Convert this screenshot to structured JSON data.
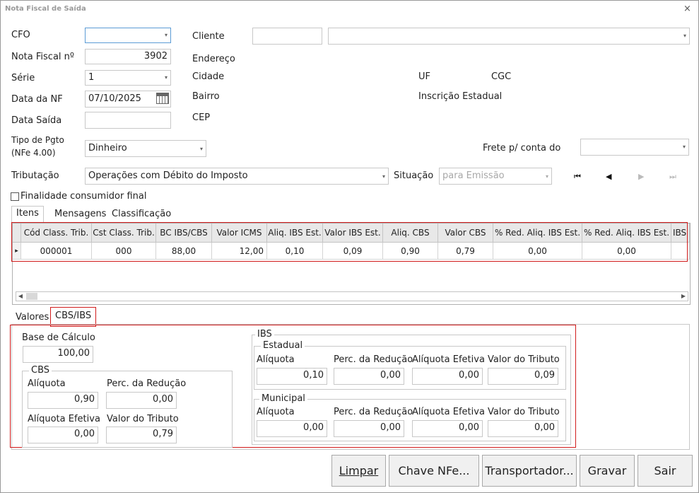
{
  "window": {
    "title": "Nota Fiscal de Saída",
    "close": "×"
  },
  "form": {
    "cfo": {
      "label": "CFO",
      "value": ""
    },
    "nota_fiscal": {
      "label": "Nota Fiscal nº",
      "value": "3902"
    },
    "serie": {
      "label": "Série",
      "value": "1"
    },
    "data_nf": {
      "label": "Data da NF",
      "value": "07/10/2025"
    },
    "data_saida": {
      "label": "Data Saída",
      "value": ""
    },
    "tipo_pgto": {
      "label1": "Tipo de Pgto",
      "label2": "(NFe 4.00)",
      "value": "Dinheiro"
    },
    "tributacao": {
      "label": "Tributação",
      "value": "Operações com Débito do Imposto"
    },
    "situacao": {
      "label": "Situação",
      "value": "para Emissão"
    },
    "cliente": {
      "label": "Cliente",
      "code": "",
      "name": ""
    },
    "endereco": {
      "label": "Endereço"
    },
    "cidade": {
      "label": "Cidade"
    },
    "bairro": {
      "label": "Bairro"
    },
    "cep": {
      "label": "CEP"
    },
    "uf": {
      "label": "UF"
    },
    "cgc": {
      "label": "CGC"
    },
    "inscricao": {
      "label": "Inscrição Estadual"
    },
    "frete": {
      "label": "Frete p/ conta do",
      "value": ""
    },
    "consumidor_final": {
      "label": "Finalidade consumidor final",
      "checked": false
    }
  },
  "nav": {
    "first": "⏮",
    "prev": "◀",
    "next": "▶",
    "last": "⏭"
  },
  "top_tabs": [
    "Itens",
    "Mensagens",
    "Classificação"
  ],
  "grid": {
    "columns": [
      "Cód Class. Trib.",
      "Cst Class. Trib.",
      "BC IBS/CBS",
      "Valor ICMS",
      "Aliq. IBS Est.",
      "Valor IBS Est.",
      "Aliq. CBS",
      "Valor CBS",
      "% Red. Aliq. IBS Est.",
      "% Red. Aliq. IBS Est.",
      "IBS"
    ],
    "rows": [
      [
        "000001",
        "000",
        "88,00",
        "12,00",
        "0,10",
        "0,09",
        "0,90",
        "0,79",
        "0,00",
        "0,00",
        ""
      ]
    ],
    "row_indicator": "▸"
  },
  "bottom_tabs": [
    "Valores",
    "CBS/IBS"
  ],
  "cbs_ibs": {
    "base_calculo": {
      "label": "Base de Cálculo",
      "value": "100,00"
    },
    "cbs": {
      "title": "CBS",
      "aliquota": {
        "label": "Alíquota",
        "value": "0,90"
      },
      "perc_reducao": {
        "label": "Perc. da Redução",
        "value": "0,00"
      },
      "aliquota_efetiva": {
        "label": "Alíquota Efetiva",
        "value": "0,00"
      },
      "valor_tributo": {
        "label": "Valor do Tributo",
        "value": "0,79"
      }
    },
    "ibs": {
      "title": "IBS",
      "estadual": {
        "title": "Estadual",
        "aliquota": {
          "label": "Alíquota",
          "value": "0,10"
        },
        "perc_reducao": {
          "label": "Perc. da Redução",
          "value": "0,00"
        },
        "aliquota_efetiva": {
          "label": "Alíquota Efetiva",
          "value": "0,00"
        },
        "valor_tributo": {
          "label": "Valor do Tributo",
          "value": "0,09"
        }
      },
      "municipal": {
        "title": "Municipal",
        "aliquota": {
          "label": "Alíquota",
          "value": "0,00"
        },
        "perc_reducao": {
          "label": "Perc. da Redução",
          "value": "0,00"
        },
        "aliquota_efetiva": {
          "label": "Alíquota Efetiva",
          "value": "0,00"
        },
        "valor_tributo": {
          "label": "Valor do Tributo",
          "value": "0,00"
        }
      }
    }
  },
  "buttons": {
    "limpar": "Limpar",
    "chave": "Chave NFe...",
    "transportador": "Transportador...",
    "gravar": "Gravar",
    "sair": "Sair"
  },
  "colors": {
    "highlight": "#d11b1b",
    "focus": "#5b9bd5"
  }
}
